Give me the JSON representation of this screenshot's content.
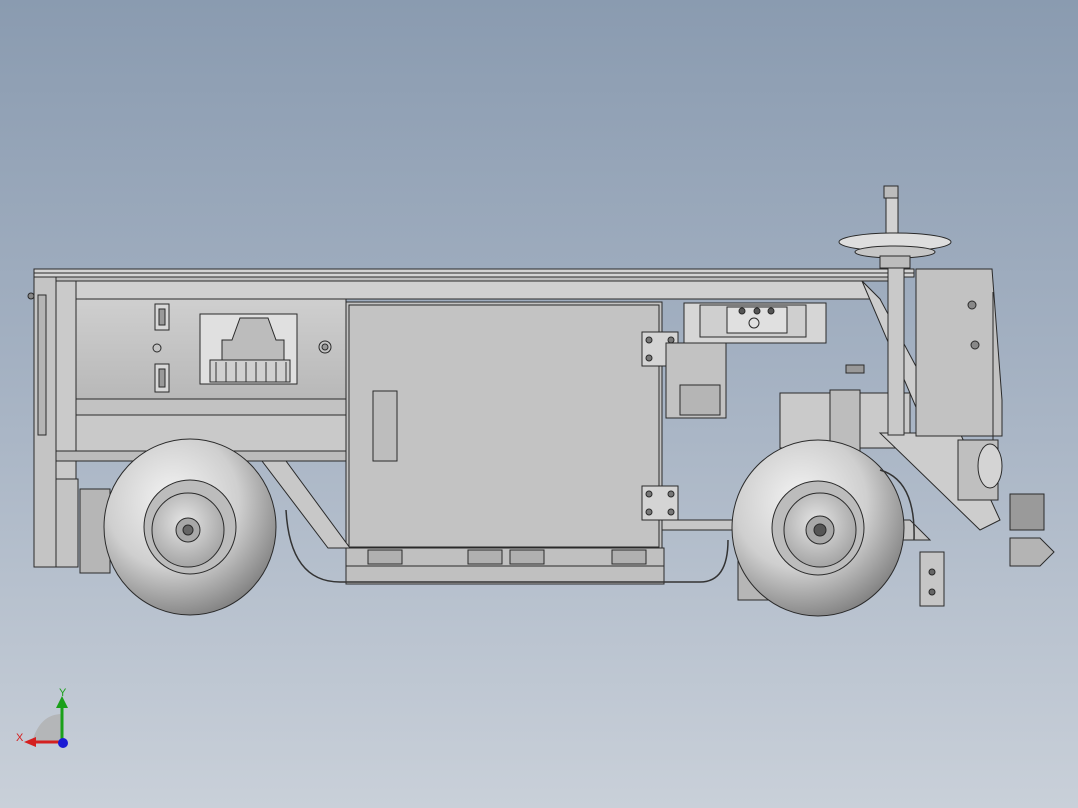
{
  "view": {
    "background_top": "#8a9bb0",
    "background_bottom": "#c9d0d9",
    "model_color": "#c8c8c8",
    "edge_color": "#2a2a2a"
  },
  "triad": {
    "x_label": "X",
    "y_label": "Y",
    "x_color": "#d42020",
    "y_color": "#1aa01a",
    "z_color": "#1a1ad4"
  }
}
